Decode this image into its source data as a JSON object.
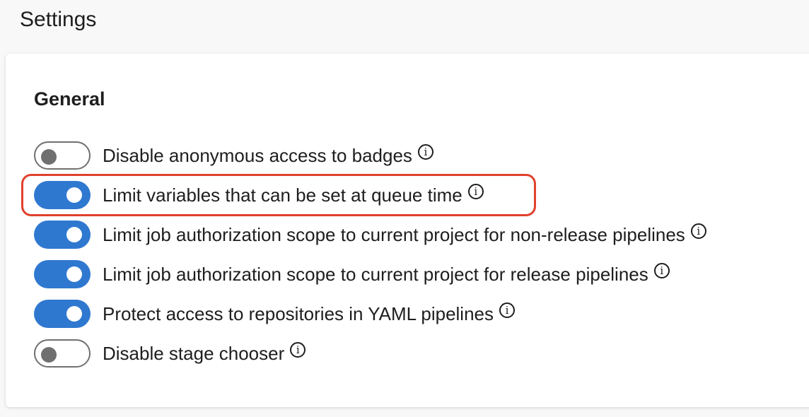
{
  "header": {
    "title": "Settings"
  },
  "section": {
    "title": "General"
  },
  "settings": [
    {
      "label": "Disable anonymous access to badges",
      "enabled": false
    },
    {
      "label": "Limit variables that can be set at queue time",
      "enabled": true,
      "highlighted": true
    },
    {
      "label": "Limit job authorization scope to current project for non-release pipelines",
      "enabled": true
    },
    {
      "label": "Limit job authorization scope to current project for release pipelines",
      "enabled": true
    },
    {
      "label": "Protect access to repositories in YAML pipelines",
      "enabled": true
    },
    {
      "label": "Disable stage chooser",
      "enabled": false
    }
  ],
  "info_glyph": "i",
  "colors": {
    "toggle_on": "#2f78d0",
    "highlight": "#e0412c"
  }
}
